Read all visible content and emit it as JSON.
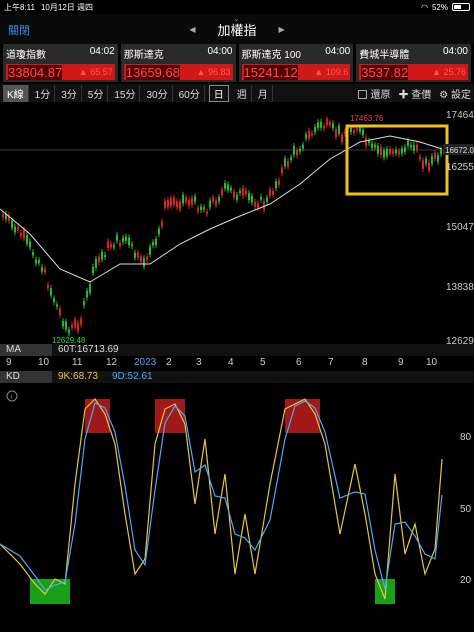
{
  "status": {
    "time": "上午8:11",
    "date": "10月12日 週四",
    "battery": "52%",
    "battery_level": 0.52
  },
  "nav": {
    "close": "關閉",
    "title": "加權指"
  },
  "quotes": [
    {
      "name": "道瓊指數",
      "time": "04:02",
      "price": "33804.87",
      "change": "65.57"
    },
    {
      "name": "那斯達克",
      "time": "04:00",
      "price": "13659.68",
      "change": "96.83"
    },
    {
      "name": "那斯達克 100",
      "time": "04:00",
      "price": "15241.12",
      "change": "109.6"
    },
    {
      "name": "費城半導體",
      "time": "04:00",
      "price": "3537.82",
      "change": "25.76"
    }
  ],
  "tabs": {
    "k_line": "K線",
    "min1": "1分",
    "min3": "3分",
    "min5": "5分",
    "min15": "15分",
    "min30": "30分",
    "min60": "60分",
    "day": "日",
    "week": "週",
    "month": "月",
    "restore": "還原",
    "query": "查價",
    "settings": "設定"
  },
  "chart": {
    "y_ticks": [
      "17464",
      "16255",
      "15047",
      "13838",
      "12629"
    ],
    "high_label": "17463.76",
    "low_label": "12629.48",
    "current_label": "16672.03"
  },
  "ma": {
    "tag": "MA",
    "value": "60T:16713.69"
  },
  "x_axis": [
    "9",
    "10",
    "11",
    "12",
    "2023",
    "2",
    "3",
    "4",
    "5",
    "6",
    "7",
    "8",
    "9",
    "10"
  ],
  "kd": {
    "tag": "KD",
    "k": "9K:68.73",
    "d": "9D:52.61",
    "y_ticks": [
      "80",
      "50",
      "20"
    ]
  },
  "colors": {
    "up": "#e02020",
    "down": "#20c020",
    "k_line": "#e8c63a",
    "d_line": "#4aa8ff",
    "highlight": "#f0c020",
    "accent": "#3b8fe8"
  }
}
